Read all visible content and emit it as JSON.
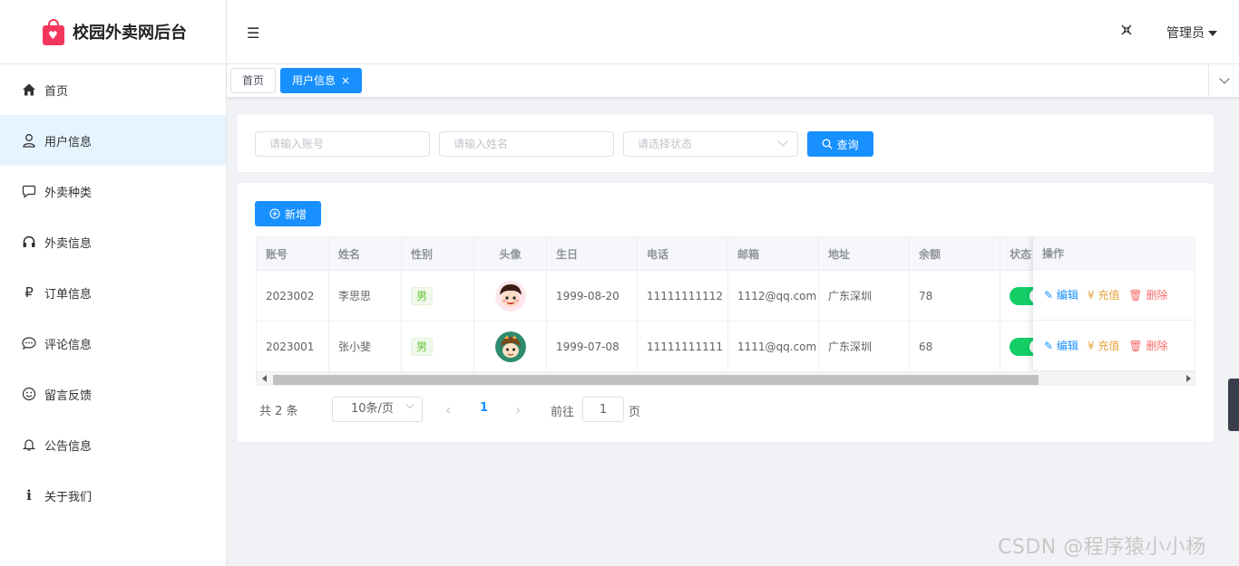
{
  "app": {
    "title": "校园外卖网后台"
  },
  "sidebar": {
    "items": [
      {
        "label": "首页",
        "icon": "home-icon"
      },
      {
        "label": "用户信息",
        "icon": "user-icon",
        "active": true
      },
      {
        "label": "外卖种类",
        "icon": "chat-bubble-icon"
      },
      {
        "label": "外卖信息",
        "icon": "headphones-icon"
      },
      {
        "label": "订单信息",
        "icon": "ruble-icon"
      },
      {
        "label": "评论信息",
        "icon": "comment-dots-icon"
      },
      {
        "label": "留言反馈",
        "icon": "smiley-icon"
      },
      {
        "label": "公告信息",
        "icon": "bell-icon"
      },
      {
        "label": "关于我们",
        "icon": "info-icon"
      }
    ]
  },
  "header": {
    "user_label": "管理员"
  },
  "tags": {
    "home": "首页",
    "current": "用户信息",
    "close": "×"
  },
  "search": {
    "account_placeholder": "请输入账号",
    "name_placeholder": "请输入姓名",
    "status_placeholder": "请选择状态",
    "query_label": "查询"
  },
  "toolbar": {
    "add_label": "新增"
  },
  "table": {
    "columns": [
      "账号",
      "姓名",
      "性别",
      "头像",
      "生日",
      "电话",
      "邮箱",
      "地址",
      "余额",
      "状态",
      "操作"
    ],
    "rows": [
      {
        "account": "2023002",
        "name": "李思思",
        "gender": "男",
        "birthday": "1999-08-20",
        "phone": "11111111112",
        "email": "1112@qq.com",
        "address": "广东深圳",
        "balance": "78",
        "status_on": true
      },
      {
        "account": "2023001",
        "name": "张小斐",
        "gender": "男",
        "birthday": "1999-07-08",
        "phone": "11111111111",
        "email": "1111@qq.com",
        "address": "广东深圳",
        "balance": "68",
        "status_on": true
      }
    ],
    "ops": {
      "edit": "编辑",
      "recharge": "充值",
      "delete": "删除"
    }
  },
  "pagination": {
    "total_label": "共 2 条",
    "page_size": "10条/页",
    "current_page": "1",
    "goto_prefix": "前往",
    "goto_value": "1",
    "goto_suffix": "页"
  },
  "watermark": "CSDN @程序猿小小杨",
  "colors": {
    "primary": "#1890ff",
    "switch_on": "#13ce66",
    "edit": "#1890ff",
    "recharge": "#e6a23c",
    "delete": "#f56c6c"
  }
}
